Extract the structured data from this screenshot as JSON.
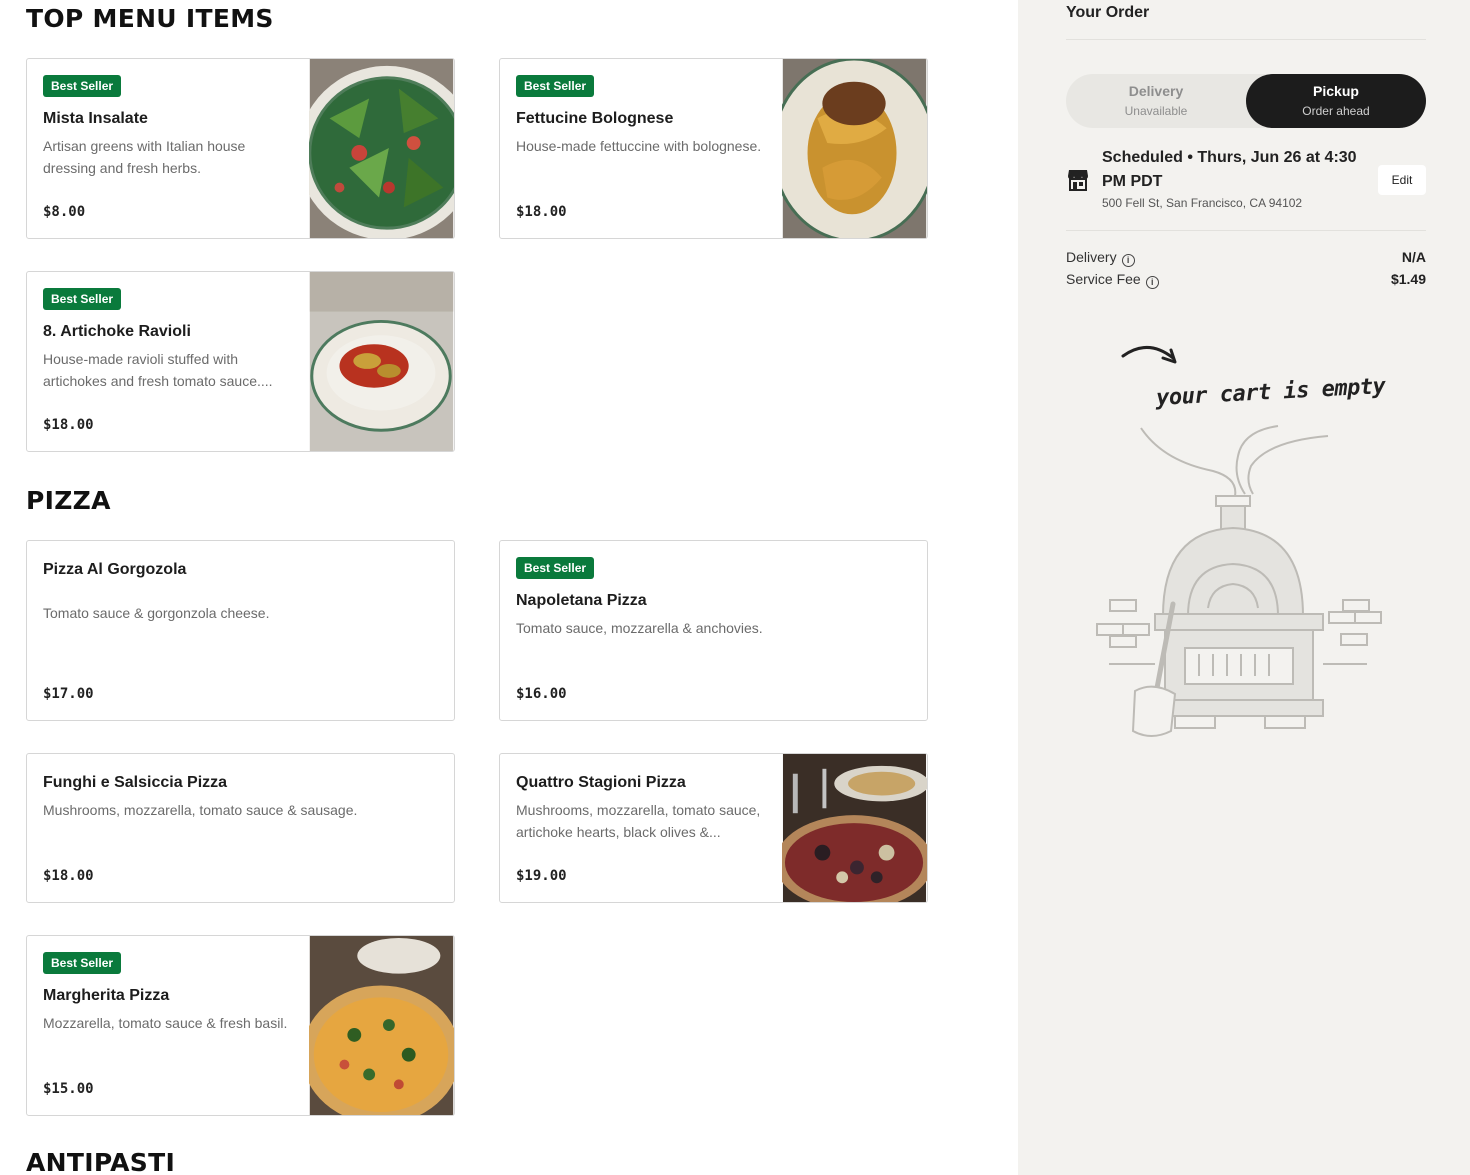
{
  "sections": {
    "top_menu_items": "TOP MENU ITEMS",
    "pizza": "PIZZA",
    "antipasti": "ANTIPASTI"
  },
  "items": [
    {
      "badge": "Best Seller",
      "name": "Mista Insalate",
      "desc": "Artisan greens with Italian house dressing and fresh herbs.",
      "price": "$8.00"
    },
    {
      "badge": "Best Seller",
      "name": "Fettucine Bolognese",
      "desc": "House-made fettuccine with bolognese.",
      "price": "$18.00"
    },
    {
      "badge": "Best Seller",
      "name": "8. Artichoke Ravioli",
      "desc": "House-made ravioli stuffed with artichokes and fresh tomato sauce....",
      "price": "$18.00"
    },
    {
      "name": "Pizza Al Gorgozola",
      "desc": "Tomato sauce & gorgonzola cheese.",
      "price": "$17.00"
    },
    {
      "badge": "Best Seller",
      "name": "Napoletana Pizza",
      "desc": "Tomato sauce, mozzarella & anchovies.",
      "price": "$16.00"
    },
    {
      "name": "Funghi e Salsiccia Pizza",
      "desc": "Mushrooms, mozzarella, tomato sauce & sausage.",
      "price": "$18.00"
    },
    {
      "name": "Quattro Stagioni Pizza",
      "desc": "Mushrooms, mozzarella, tomato sauce, artichoke hearts, black olives &...",
      "price": "$19.00"
    },
    {
      "badge": "Best Seller",
      "name": "Margherita Pizza",
      "desc": "Mozzarella, tomato sauce & fresh basil.",
      "price": "$15.00"
    }
  ],
  "order": {
    "title": "Your Order",
    "delivery_label": "Delivery",
    "delivery_sub": "Unavailable",
    "pickup_label": "Pickup",
    "pickup_sub": "Order ahead",
    "scheduled": "Scheduled • Thurs, Jun 26 at 4:30 PM PDT",
    "address": "500 Fell St, San Francisco, CA 94102",
    "edit_label": "Edit",
    "fees": [
      {
        "label": "Delivery",
        "value": "N/A"
      },
      {
        "label": "Service Fee",
        "value": "$1.49"
      }
    ],
    "empty_text": "your cart is empty"
  },
  "colors": {
    "badge": "#0a7a3c",
    "sidebar_bg": "#f3f2ef",
    "pickup_bg": "#1c1c1c"
  },
  "icons": {
    "store": "store-icon",
    "info": "info-icon",
    "arrow": "arrow-icon"
  }
}
